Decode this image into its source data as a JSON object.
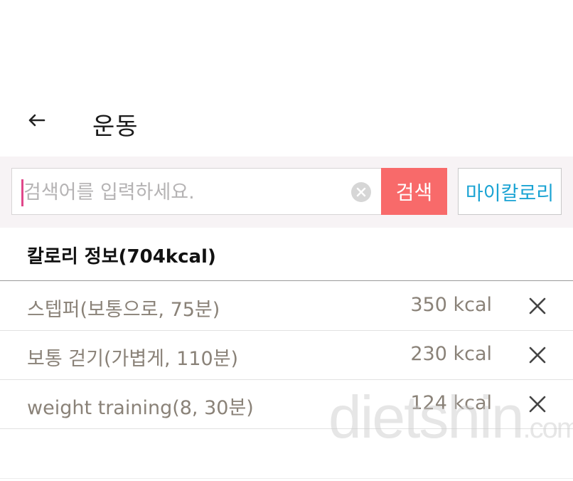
{
  "header": {
    "title": "운동",
    "back_icon": "arrow-left-icon"
  },
  "search": {
    "placeholder": "검색어를 입력하세요.",
    "value": "",
    "clear_icon": "clear-circle-icon",
    "button_label": "검색",
    "my_calorie_label": "마이칼로리"
  },
  "calorie_info": {
    "heading": "칼로리 정보(704kcal)"
  },
  "entries": [
    {
      "name": "스텝퍼(보통으로, 75분)",
      "kcal": "350 kcal",
      "delete_icon": "close-icon"
    },
    {
      "name": "보통 걷기(가볍게, 110분)",
      "kcal": "230 kcal",
      "delete_icon": "close-icon"
    },
    {
      "name": "weight training(8, 30분)",
      "kcal": "124 kcal",
      "delete_icon": "close-icon"
    }
  ],
  "watermark": {
    "text": "dietshin",
    "suffix": ".com"
  },
  "colors": {
    "search_button": "#f86a6a",
    "my_calorie_text": "#1aa3d3",
    "entry_text": "#8a8278",
    "caret": "#e0478a",
    "search_band": "#f7f3f5"
  }
}
